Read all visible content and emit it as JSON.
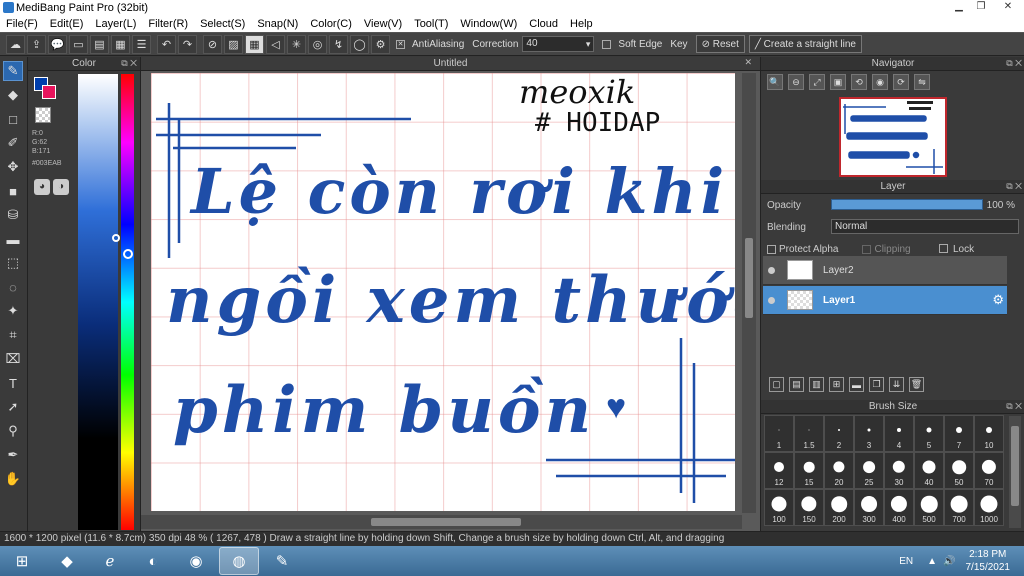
{
  "window": {
    "title": "MediBang Paint Pro (32bit)"
  },
  "menu": [
    "File(F)",
    "Edit(E)",
    "Layer(L)",
    "Filter(R)",
    "Select(S)",
    "Snap(N)",
    "Color(C)",
    "View(V)",
    "Tool(T)",
    "Window(W)",
    "Cloud",
    "Help"
  ],
  "toolbar": {
    "antialiasing_label": "AntiAliasing",
    "correction_label": "Correction",
    "correction_value": "40",
    "softedge_label": "Soft Edge",
    "key_label": "Key",
    "reset_label": "Reset",
    "straight_label": "Create a straight line"
  },
  "color_panel": {
    "title": "Color",
    "r": "R:0",
    "g": "G:62",
    "b": "B:171",
    "hex": "#003EAB",
    "primary": "#003EAB",
    "secondary": "#e8145c"
  },
  "document": {
    "tab": "Untitled",
    "signature": "meoxik",
    "hashtag": "# HOIDAP",
    "line1": "Lệ còn rơi khi",
    "line2": "ngồi xem thước",
    "line3": "phim buồn",
    "ink_color": "#1f4ea8"
  },
  "navigator": {
    "title": "Navigator"
  },
  "layer_panel": {
    "title": "Layer",
    "opacity_label": "Opacity",
    "opacity_value": "100 %",
    "opacity_fraction": 1.0,
    "blending_label": "Blending",
    "blending_value": "Normal",
    "protect_alpha": "Protect Alpha",
    "clipping": "Clipping",
    "lock": "Lock",
    "layers": [
      {
        "name": "Layer2"
      },
      {
        "name": "Layer1"
      }
    ]
  },
  "brush_panel": {
    "title": "Brush Size",
    "sizes": [
      "1",
      "1.5",
      "2",
      "3",
      "4",
      "5",
      "7",
      "10",
      "12",
      "15",
      "20",
      "25",
      "30",
      "40",
      "50",
      "70",
      "100",
      "150",
      "200",
      "300",
      "400",
      "500",
      "700",
      "1000"
    ]
  },
  "status": {
    "text": "1600 * 1200 pixel   (11.6 * 8.7cm)   350 dpi   48 %   ( 1267, 478 )   Draw a straight line by holding down Shift, Change a brush size by holding down Ctrl, Alt, and dragging"
  },
  "taskbar": {
    "lang": "EN",
    "time": "2:18 PM",
    "date": "7/15/2021"
  }
}
